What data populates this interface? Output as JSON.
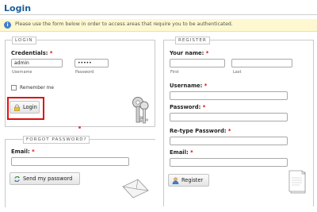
{
  "page": {
    "title": "Login"
  },
  "notice": {
    "text": "Please use the form below in order to access areas that require you to be authenticated."
  },
  "login": {
    "legend": "LOGIN",
    "credentials_label": "Credentials:",
    "username_value": "admin",
    "password_value": "•••••",
    "username_sublabel": "Username",
    "password_sublabel": "Password",
    "remember_label": "Remember me",
    "login_button": "Login"
  },
  "forgot": {
    "legend": "FORGOT PASSWORD?",
    "email_label": "Email:",
    "email_value": "",
    "send_button": "Send my password"
  },
  "register": {
    "legend": "REGISTER",
    "name_label": "Your name:",
    "first_sublabel": "First",
    "last_sublabel": "Last",
    "username_label": "Username:",
    "password_label": "Password:",
    "retype_label": "Re-type Password:",
    "email_label": "Email:",
    "register_button": "Register"
  },
  "required_mark": "*",
  "colors": {
    "title": "#1b5e9b",
    "highlight": "#e01010",
    "notice_bg": "#fdf8d0"
  }
}
